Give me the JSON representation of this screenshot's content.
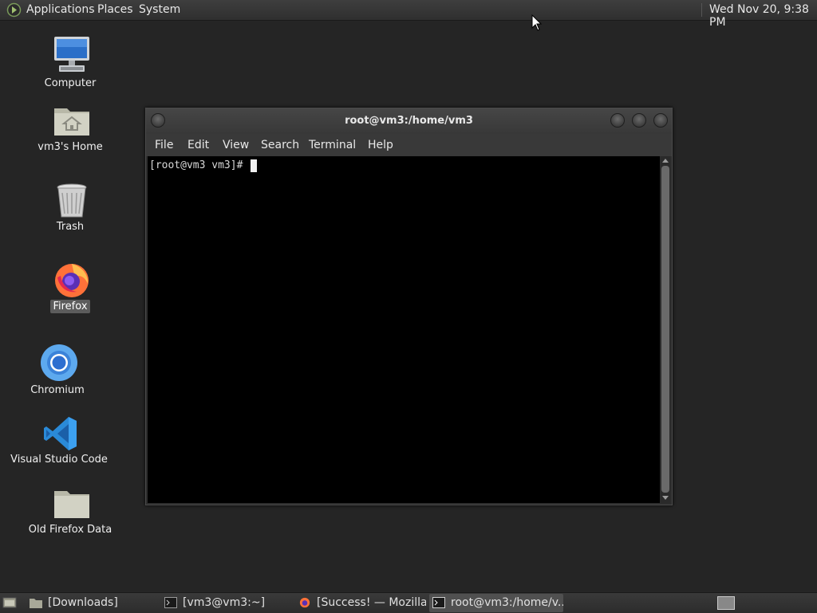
{
  "top_panel": {
    "menus": [
      "Applications",
      "Places",
      "System"
    ],
    "clock": "Wed Nov 20,  9:38 PM"
  },
  "desktop_icons": [
    {
      "label": "Computer",
      "icon": "computer-icon"
    },
    {
      "label": "vm3's Home",
      "icon": "home-folder-icon"
    },
    {
      "label": "Trash",
      "icon": "trash-icon"
    },
    {
      "label": "Firefox",
      "icon": "firefox-icon",
      "selected": true
    },
    {
      "label": "Chromium",
      "icon": "chromium-icon"
    },
    {
      "label": "Visual Studio Code",
      "icon": "vscode-icon"
    },
    {
      "label": "Old Firefox Data",
      "icon": "folder-icon"
    }
  ],
  "terminal": {
    "title": "root@vm3:/home/vm3",
    "menu": [
      "File",
      "Edit",
      "View",
      "Search",
      "Terminal",
      "Help"
    ],
    "prompt": "[root@vm3 vm3]# "
  },
  "taskbar": {
    "items": [
      {
        "label": "[Downloads]",
        "icon": "folder-icon",
        "active": false
      },
      {
        "label": "[vm3@vm3:~]",
        "icon": "terminal-icon",
        "active": false
      },
      {
        "label": "[Success! — Mozilla ...",
        "icon": "firefox-icon",
        "active": false
      },
      {
        "label": "root@vm3:/home/v...",
        "icon": "terminal-icon",
        "active": true
      }
    ]
  },
  "colors": {
    "desktop_bg": "#252525",
    "terminal_bg": "#000000",
    "panel_bg": "#333333",
    "selection": "#5c5c5c"
  }
}
